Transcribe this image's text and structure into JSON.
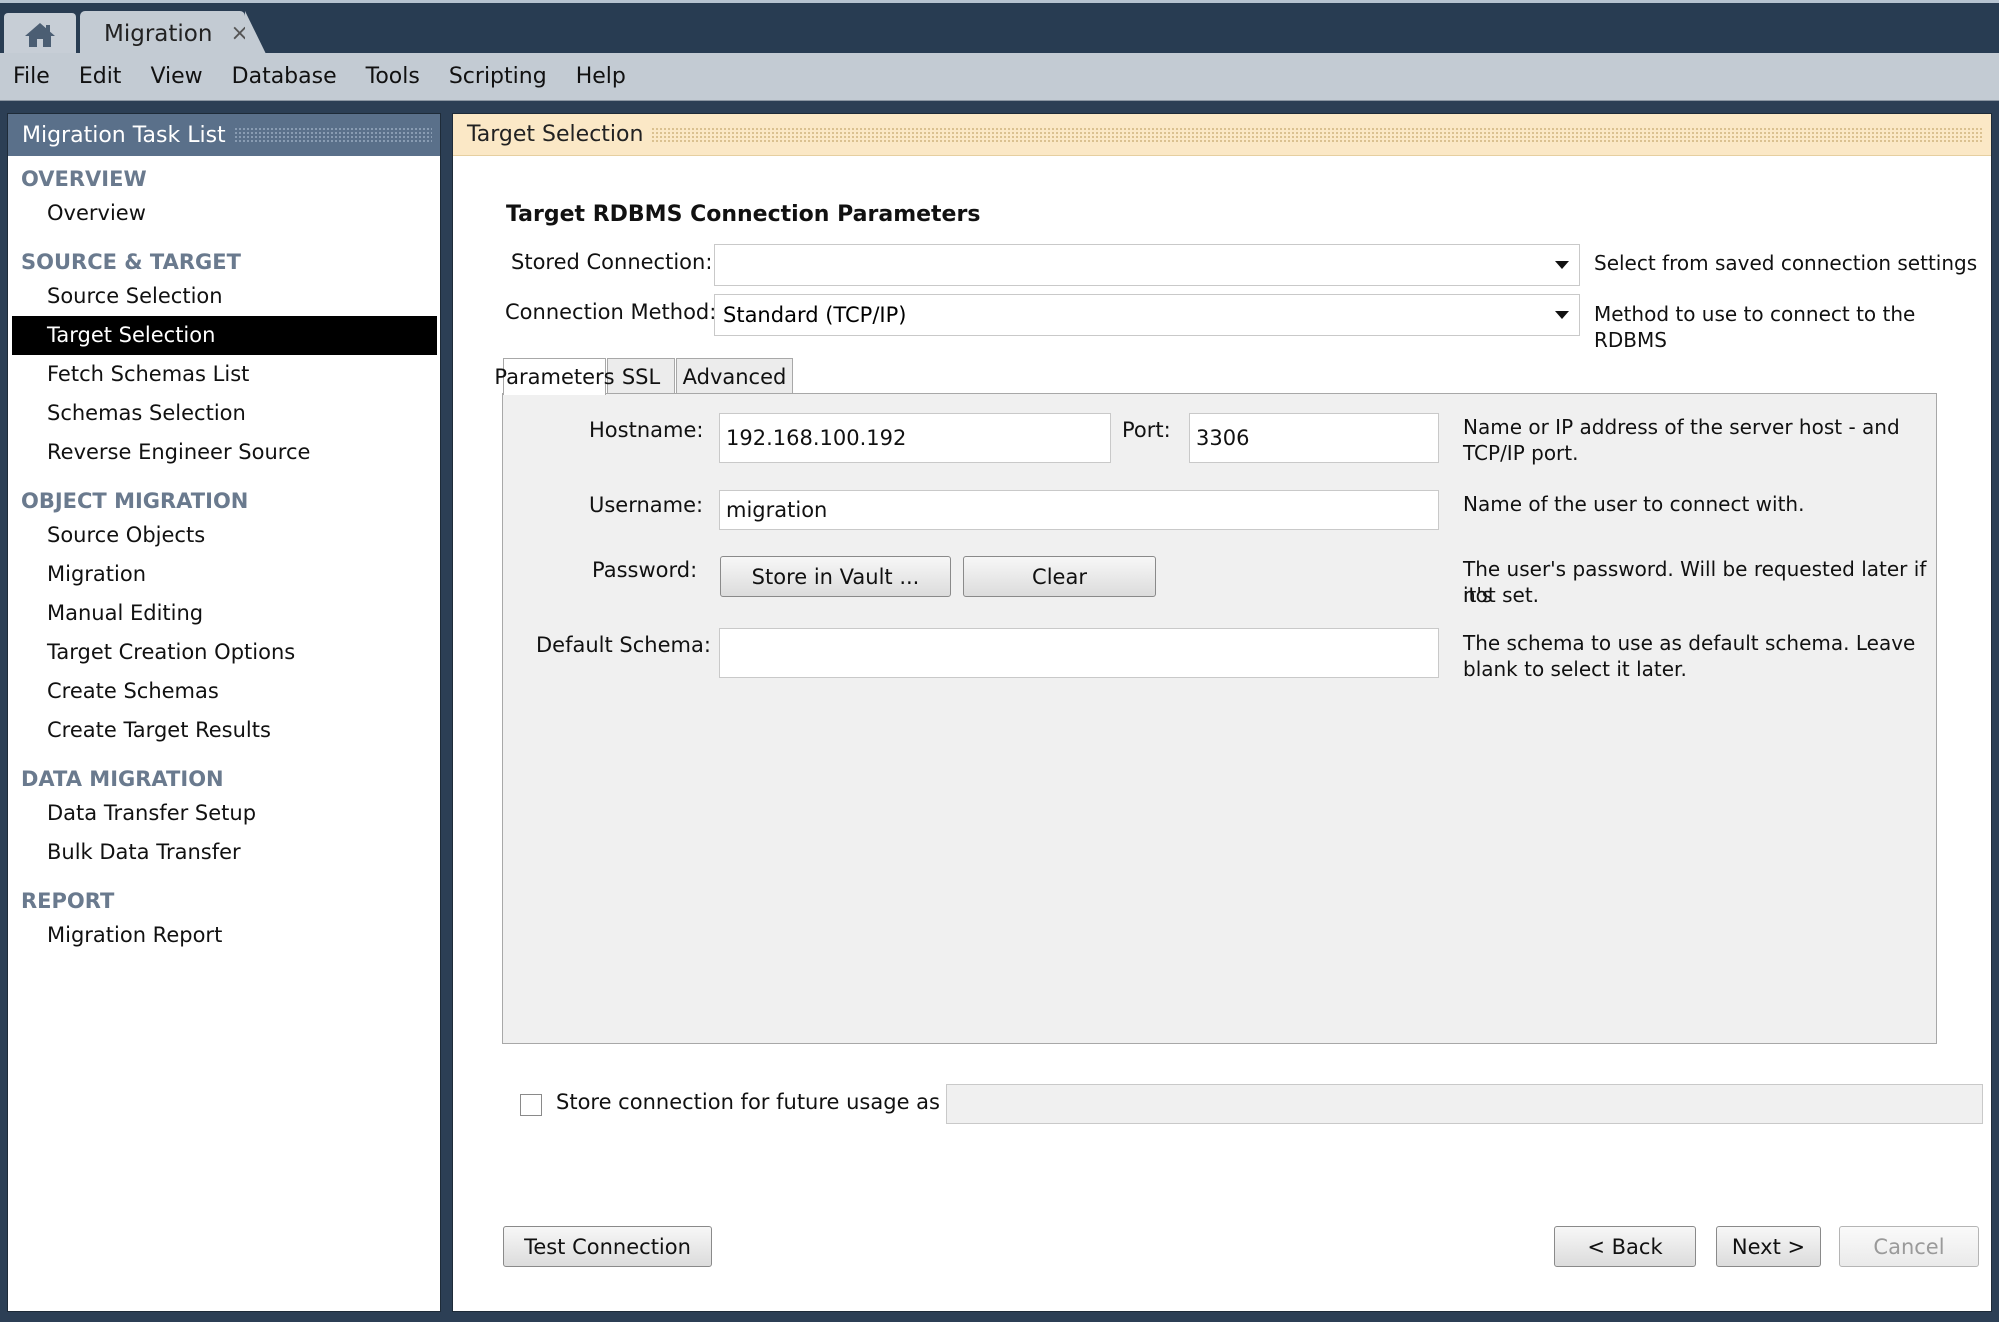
{
  "tabs": {
    "doc_tab_label": "Migration",
    "close_glyph": "×",
    "home_icon": "home-icon"
  },
  "menu": [
    "File",
    "Edit",
    "View",
    "Database",
    "Tools",
    "Scripting",
    "Help"
  ],
  "sidebar": {
    "title": "Migration Task List",
    "sections": [
      {
        "title": "OVERVIEW",
        "items": [
          "Overview"
        ]
      },
      {
        "title": "SOURCE & TARGET",
        "items": [
          "Source Selection",
          "Target Selection",
          "Fetch Schemas List",
          "Schemas Selection",
          "Reverse Engineer Source"
        ]
      },
      {
        "title": "OBJECT MIGRATION",
        "items": [
          "Source Objects",
          "Migration",
          "Manual Editing",
          "Target Creation Options",
          "Create Schemas",
          "Create Target Results"
        ]
      },
      {
        "title": "DATA MIGRATION",
        "items": [
          "Data Transfer Setup",
          "Bulk Data Transfer"
        ]
      },
      {
        "title": "REPORT",
        "items": [
          "Migration Report"
        ]
      }
    ],
    "selected_item": "Target Selection"
  },
  "page": {
    "header_title": "Target Selection",
    "section_title": "Target RDBMS Connection Parameters",
    "stored_connection": {
      "label": "Stored Connection:",
      "value": "",
      "help": "Select from saved connection settings"
    },
    "connection_method": {
      "label": "Connection Method:",
      "value": "Standard (TCP/IP)",
      "help": "Method to use to connect to the RDBMS"
    },
    "subtabs": [
      "Parameters",
      "SSL",
      "Advanced"
    ],
    "active_subtab": "Parameters",
    "hostname": {
      "label": "Hostname:",
      "value": "192.168.100.192"
    },
    "port": {
      "label": "Port:",
      "value": "3306"
    },
    "host_help_1": "Name or IP address of the server host - and",
    "host_help_2": "TCP/IP port.",
    "username": {
      "label": "Username:",
      "value": "migration",
      "help": "Name of the user to connect with."
    },
    "password": {
      "label": "Password:",
      "store_button": "Store in Vault ...",
      "clear_button": "Clear"
    },
    "password_help_1": "The user's password. Will be requested later if it's",
    "password_help_2": "not set.",
    "default_schema": {
      "label": "Default Schema:",
      "value": ""
    },
    "schema_help_1": "The schema to use as default schema. Leave",
    "schema_help_2": "blank to select it later.",
    "store_connection": {
      "label": "Store connection for future usage as",
      "checked": false,
      "value": ""
    },
    "buttons": {
      "test": "Test Connection",
      "back": "< Back",
      "next": "Next >",
      "cancel": "Cancel"
    }
  }
}
